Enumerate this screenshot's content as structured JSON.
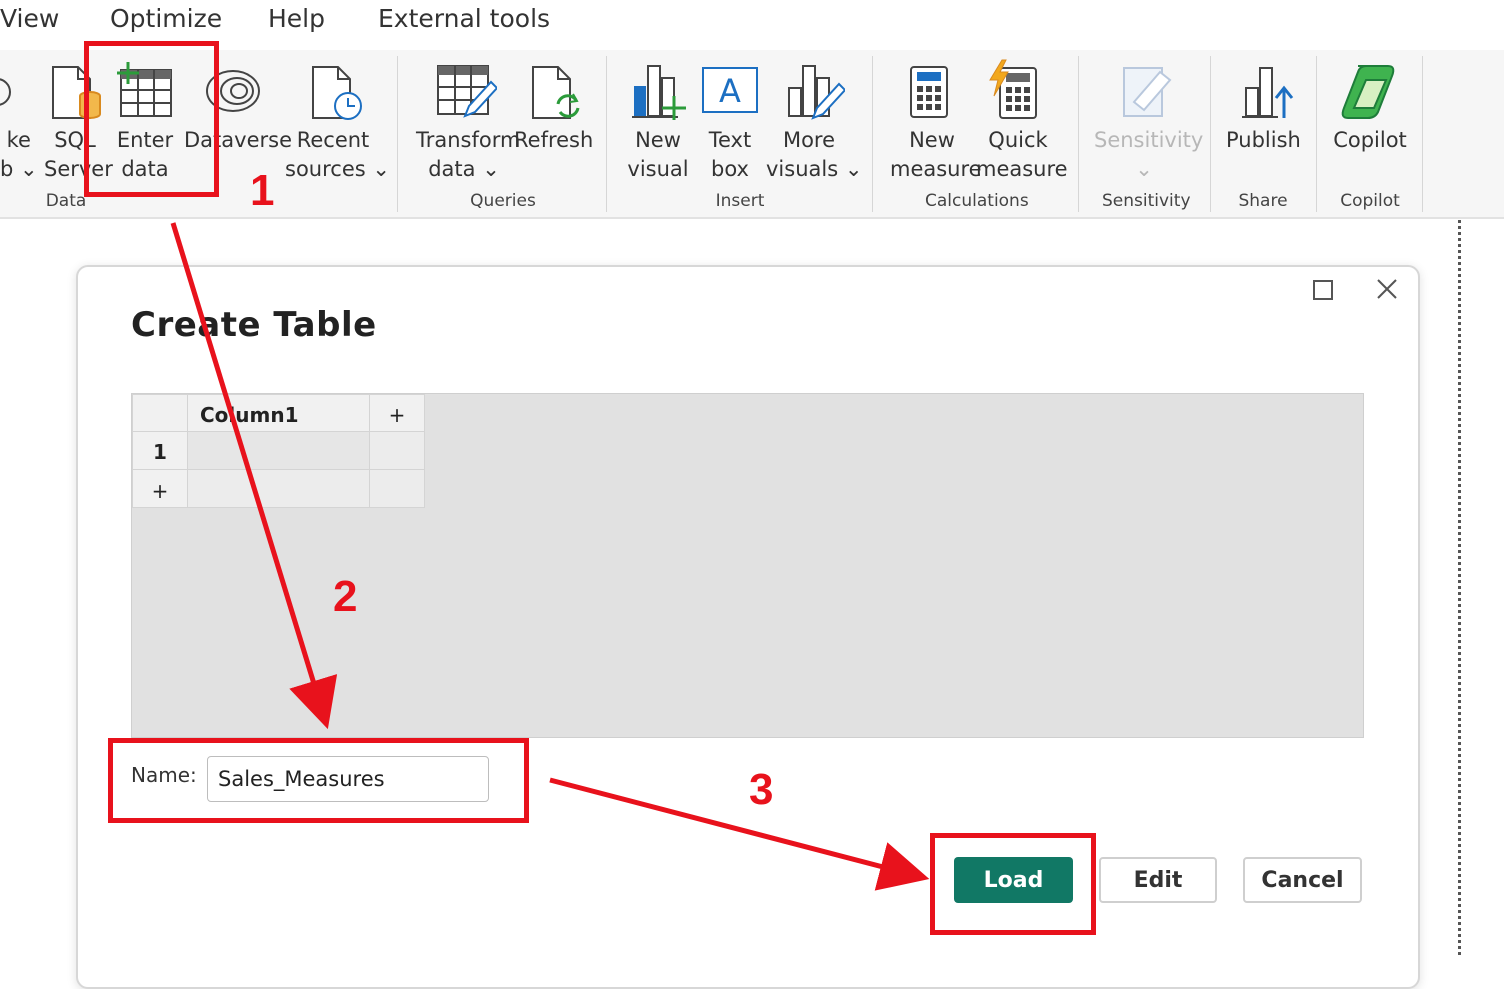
{
  "menu": {
    "view": "View",
    "optimize": "Optimize",
    "help": "Help",
    "external_tools": "External tools"
  },
  "ribbon": {
    "lake_line1": "ke",
    "lake_line2": "b",
    "sql_line1": "SQL",
    "sql_line2": "Server",
    "enter_line1": "Enter",
    "enter_line2": "data",
    "dataverse": "Dataverse",
    "recent_line1": "Recent",
    "recent_line2": "sources",
    "transform_line1": "Transform",
    "transform_line2": "data",
    "refresh": "Refresh",
    "new_visual_line1": "New",
    "new_visual_line2": "visual",
    "text_box_line1": "Text",
    "text_box_line2": "box",
    "more_visuals_line1": "More",
    "more_visuals_line2": "visuals",
    "new_measure_line1": "New",
    "new_measure_line2": "measure",
    "quick_measure_line1": "Quick",
    "quick_measure_line2": "measure",
    "sensitivity": "Sensitivity",
    "publish": "Publish",
    "copilot": "Copilot",
    "groups": {
      "data": "Data",
      "queries": "Queries",
      "insert": "Insert",
      "calculations": "Calculations",
      "sensitivity": "Sensitivity",
      "share": "Share",
      "copilot": "Copilot"
    }
  },
  "dialog": {
    "title": "Create Table",
    "table": {
      "column_header": "Column1",
      "add_column": "+",
      "row_number": "1",
      "add_row": "+"
    },
    "name_label": "Name:",
    "name_value": "Sales_Measures",
    "buttons": {
      "load": "Load",
      "edit": "Edit",
      "cancel": "Cancel"
    }
  },
  "annotations": {
    "step1": "1",
    "step2": "2",
    "step3": "3"
  },
  "colors": {
    "accent": "#117865",
    "annotation": "#e8121c"
  }
}
